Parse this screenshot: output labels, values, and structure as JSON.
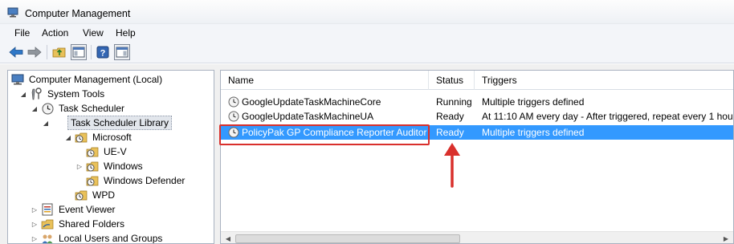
{
  "window": {
    "title": "Computer Management"
  },
  "menu": [
    "File",
    "Action",
    "View",
    "Help"
  ],
  "toolbar": {
    "icons": [
      "back-arrow-icon",
      "forward-arrow-icon",
      "up-folder-icon",
      "show-hide-tree-icon",
      "help-icon",
      "show-action-pane-icon"
    ]
  },
  "tree": {
    "items": [
      {
        "label": "Computer Management (Local)",
        "icon": "computer-management-icon",
        "expander": ""
      },
      {
        "label": "System Tools",
        "icon": "tools-icon",
        "expander": "open"
      },
      {
        "label": "Task Scheduler",
        "icon": "clock-icon",
        "expander": "open"
      },
      {
        "label": "Task Scheduler Library",
        "icon": "folder-icon",
        "expander": "",
        "selected": true
      },
      {
        "label": "Microsoft",
        "icon": "folder-clock-icon",
        "expander": "open"
      },
      {
        "label": "UE-V",
        "icon": "folder-clock-icon",
        "expander": ""
      },
      {
        "label": "Windows",
        "icon": "folder-clock-icon",
        "expander": "closed"
      },
      {
        "label": "Windows Defender",
        "icon": "folder-clock-icon",
        "expander": ""
      },
      {
        "label": "WPD",
        "icon": "folder-clock-icon",
        "expander": ""
      },
      {
        "label": "Event Viewer",
        "icon": "event-viewer-icon",
        "expander": "closed"
      },
      {
        "label": "Shared Folders",
        "icon": "shared-folders-icon",
        "expander": "closed"
      },
      {
        "label": "Local Users and Groups",
        "icon": "users-icon",
        "expander": "closed"
      }
    ]
  },
  "list": {
    "columns": [
      "Name",
      "Status",
      "Triggers"
    ],
    "rows": [
      {
        "name": "GoogleUpdateTaskMachineCore",
        "status": "Running",
        "triggers": "Multiple triggers defined"
      },
      {
        "name": "GoogleUpdateTaskMachineUA",
        "status": "Ready",
        "triggers": "At 11:10 AM every day - After triggered, repeat every 1 hou"
      },
      {
        "name": "PolicyPak GP Compliance Reporter Auditor",
        "status": "Ready",
        "triggers": "Multiple triggers defined",
        "selected": true
      }
    ]
  },
  "colors": {
    "selection": "#3399ff",
    "annotation": "#d9302c"
  }
}
